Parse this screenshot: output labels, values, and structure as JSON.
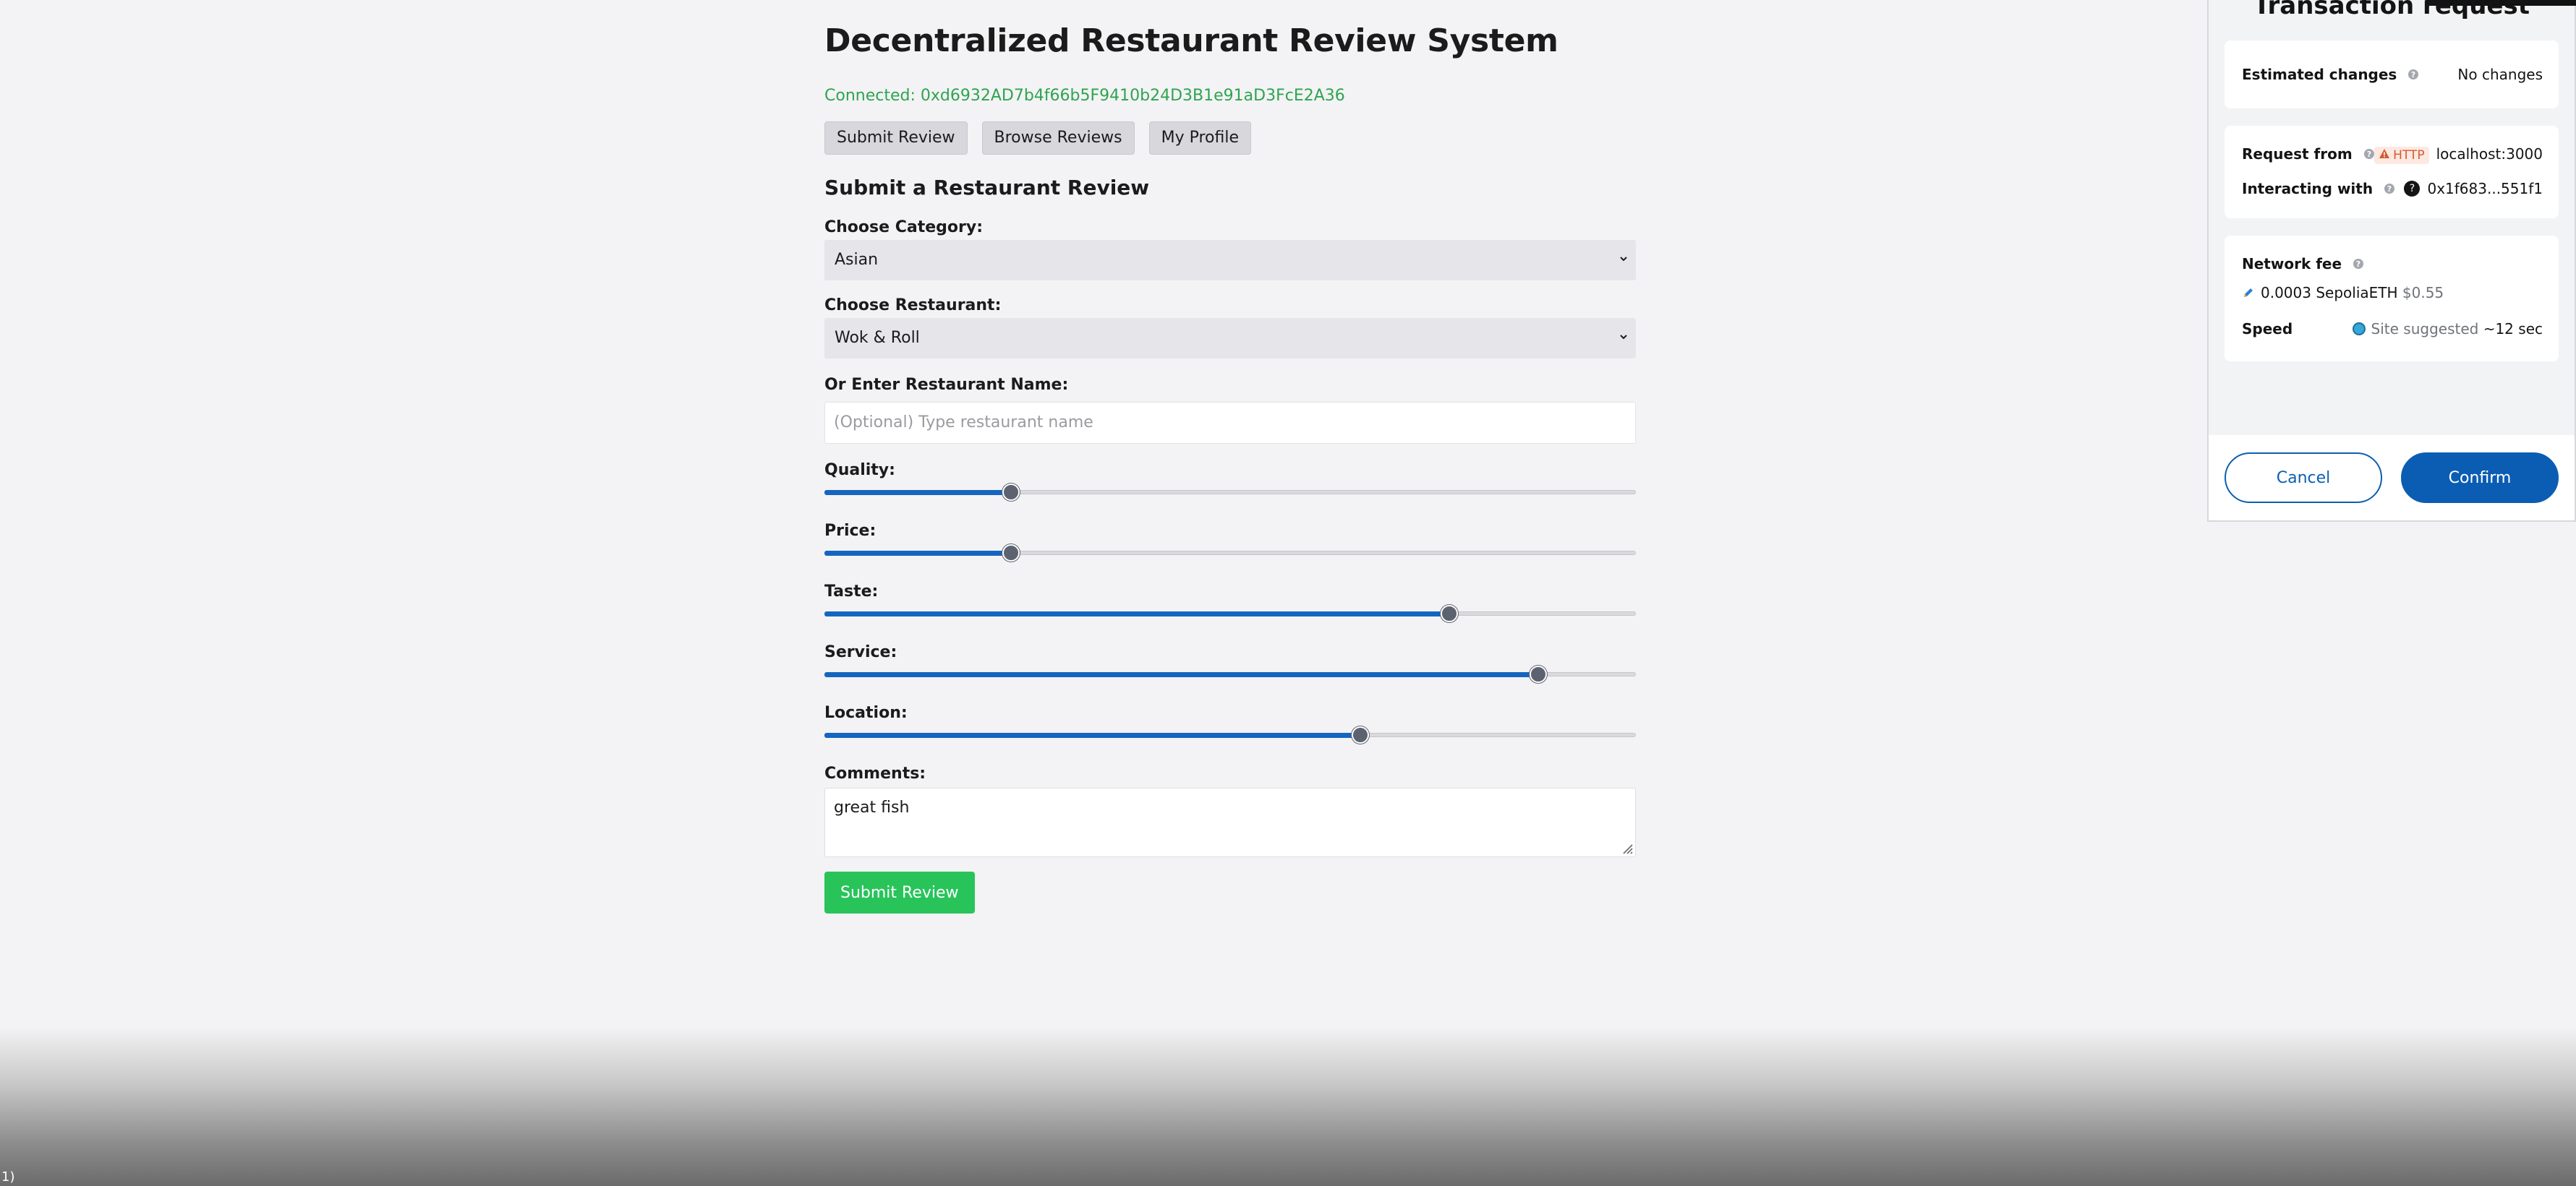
{
  "app": {
    "title": "Decentralized Restaurant Review System",
    "connected": "Connected: 0xd6932AD7b4f66b5F9410b24D3B1e91aD3FcE2A36",
    "nav": [
      {
        "label": "Submit Review"
      },
      {
        "label": "Browse Reviews"
      },
      {
        "label": "My Profile"
      }
    ]
  },
  "form": {
    "title": "Submit a Restaurant Review",
    "category": {
      "label": "Choose Category:",
      "value": "Asian"
    },
    "restaurant": {
      "label": "Choose Restaurant:",
      "value": "Wok & Roll"
    },
    "restaurant_name": {
      "label": "Or Enter Restaurant Name:",
      "placeholder": "(Optional) Type restaurant name"
    },
    "sliders": [
      {
        "label": "Quality:",
        "level": 0.23
      },
      {
        "label": "Price:",
        "level": 0.23
      },
      {
        "label": "Taste:",
        "level": 0.77
      },
      {
        "label": "Service:",
        "level": 0.88
      },
      {
        "label": "Location:",
        "level": 0.66
      }
    ],
    "comments": {
      "label": "Comments:",
      "value": "great fish"
    },
    "submit_label": "Submit Review"
  },
  "corner_text": "1)",
  "wallet": {
    "title": "Transaction request",
    "estimated_changes_label": "Estimated changes",
    "estimated_changes_value": "No changes",
    "request_from_label": "Request from",
    "http_badge": "HTTP",
    "request_from_value": "localhost:3000",
    "interacting_with_label": "Interacting with",
    "interacting_with_value": "0x1f683...551f1",
    "network_fee_label": "Network fee",
    "fee_amount": "0.0003 SepoliaETH",
    "fee_fiat": "$0.55",
    "speed_label": "Speed",
    "speed_source": "Site suggested",
    "speed_time": "~12 sec",
    "cancel_label": "Cancel",
    "confirm_label": "Confirm"
  },
  "colors": {
    "accent": "#1565c0",
    "success": "#28c45a",
    "connected_text": "#2ea44f",
    "wallet_primary": "#0b5db3"
  }
}
